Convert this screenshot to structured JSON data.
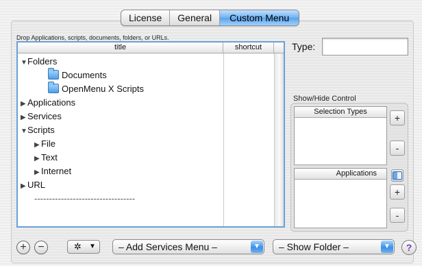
{
  "tabs": [
    {
      "label": "License",
      "selected": false
    },
    {
      "label": "General",
      "selected": false
    },
    {
      "label": "Custom Menu",
      "selected": true
    }
  ],
  "drop_hint": "Drop Applications, scripts, documents, folders, or URLs.",
  "outline": {
    "columns": {
      "title": "title",
      "shortcut": "shortcut"
    },
    "rows": [
      {
        "label": "Folders",
        "disclosure": "▼",
        "icon": "",
        "indent": 0
      },
      {
        "label": "Documents",
        "disclosure": "",
        "icon": "folder-icon",
        "indent": 2
      },
      {
        "label": "OpenMenu X Scripts",
        "disclosure": "",
        "icon": "folder-icon",
        "indent": 2
      },
      {
        "label": "Applications",
        "disclosure": "▶",
        "icon": "",
        "indent": 0
      },
      {
        "label": "Services",
        "disclosure": "▶",
        "icon": "",
        "indent": 0
      },
      {
        "label": "Scripts",
        "disclosure": "▼",
        "icon": "",
        "indent": 0
      },
      {
        "label": "File",
        "disclosure": "▶",
        "icon": "",
        "indent": 1
      },
      {
        "label": "Text",
        "disclosure": "▶",
        "icon": "",
        "indent": 1
      },
      {
        "label": "Internet",
        "disclosure": "▶",
        "icon": "",
        "indent": 1
      },
      {
        "label": "URL",
        "disclosure": "▶",
        "icon": "",
        "indent": 0
      },
      {
        "label": "----------------------------------",
        "disclosure": "",
        "icon": "",
        "indent": 1
      }
    ]
  },
  "type_field": {
    "label": "Type:",
    "value": ""
  },
  "show_hide": {
    "label": "Show/Hide Control",
    "selection_types_header": "Selection Types",
    "applications_header": "Applications",
    "add_label": "+",
    "remove_label": "-"
  },
  "bottom": {
    "add_label": "+",
    "remove_label": "−",
    "gear_glyph": "✲",
    "gear_arrow": "▼",
    "services_popup": "– Add Services Menu –",
    "folder_popup": "– Show Folder –",
    "popup_arrow": "▼",
    "help_label": "?"
  },
  "colors": {
    "accent": "#5aa3ea",
    "help": "#7a3fb8"
  }
}
